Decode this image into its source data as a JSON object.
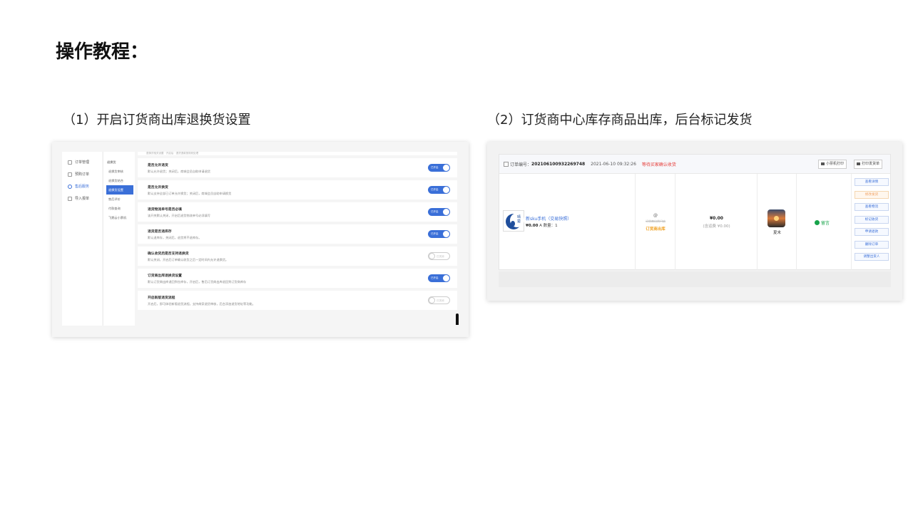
{
  "title": "操作教程：",
  "captions": {
    "step1": "（1）开启订货商出库退换货设置",
    "step2": "（2）订货商中心库存商品出库，后台标记发货"
  },
  "screenshot1": {
    "nav": [
      {
        "label": "订单管理",
        "icon": "order-icon"
      },
      {
        "label": "预购订单",
        "icon": "preorder-icon"
      },
      {
        "label": "售后服务",
        "icon": "aftersale-icon",
        "active": true
      },
      {
        "label": "导入报单",
        "icon": "import-icon"
      }
    ],
    "sub_nav": [
      {
        "label": "退换货",
        "head": true
      },
      {
        "label": "退换货审核"
      },
      {
        "label": "退换货结合"
      },
      {
        "label": "退换货设置",
        "active": true
      },
      {
        "label": "售后评价"
      },
      {
        "label": "付款查询"
      },
      {
        "label": "飞鹅云小票机"
      }
    ],
    "top_text": "退换货相关设置 · 开启后 · 退货退款按规则处理",
    "settings": [
      {
        "title": "是否允许退货",
        "desc": "默认允许退货；关闭后，商城会员自助申请退货",
        "state": "on",
        "toggle_label": "已开启"
      },
      {
        "title": "是否允许换货",
        "desc": "默认支持全部已订单允许换货；关闭后，商城会员自助申请换货",
        "state": "on",
        "toggle_label": "已开启"
      },
      {
        "title": "退货物流单号是否必填",
        "desc": "该开关默认关闭，开启后退货物流单号必须填写",
        "state": "on",
        "toggle_label": "已开启"
      },
      {
        "title": "退货是否退库存",
        "desc": "默认退库存，关闭后，退货将不退库存。",
        "state": "on",
        "toggle_label": "已开启"
      },
      {
        "title": "确认收货后是否支持退换货",
        "desc": "默认关闭，开启后订单确认收货之后一定时间内允许退换货。",
        "state": "off",
        "toggle_label": "已关闭"
      },
      {
        "title": "订货商出库退换货设置",
        "desc": "默认订货商出库退回到仓库存，开启后，售后订货商出库退回到订货商库存",
        "state": "on",
        "toggle_label": "已开启"
      },
      {
        "title": "开启新版退货流程",
        "desc": "开启后，即可体验新版退货流程。支持商家退货审核，后台添加退货地址等功能。",
        "state": "off",
        "toggle_label": "已关闭"
      }
    ]
  },
  "screenshot2": {
    "order_label": "订单编号：",
    "order_number": "2021061009322697​48",
    "order_time": "2021-06-10 09:32:26",
    "status": "等待买家确认收货",
    "print_buttons": [
      "小票机打印",
      "打印发货单"
    ],
    "product": {
      "logo_text": "晴楚",
      "name": "新sku手机（交易快照）",
      "price": "¥0.00",
      "spec": "A 数量：1"
    },
    "warehouse": {
      "at": "@",
      "strike": "订货商出货门店",
      "label": "订货商出库"
    },
    "amount": "¥0.00",
    "shipping": "(含运费 ¥0.00)",
    "buyer_name": "夏末",
    "chat_label": "留言",
    "actions": [
      {
        "label": "查看详情",
        "style": "normal"
      },
      {
        "label": "修改发货",
        "style": "warn"
      },
      {
        "label": "查看物流",
        "style": "normal"
      },
      {
        "label": "标记收货",
        "style": "normal"
      },
      {
        "label": "申请退款",
        "style": "normal"
      },
      {
        "label": "删除订单",
        "style": "normal"
      },
      {
        "label": "调整出货人",
        "style": "normal"
      }
    ],
    "colors": {
      "accent": "#3a6fd8",
      "status": "#e53935",
      "warehouse": "#f0a020",
      "chat": "#17a34a"
    }
  }
}
